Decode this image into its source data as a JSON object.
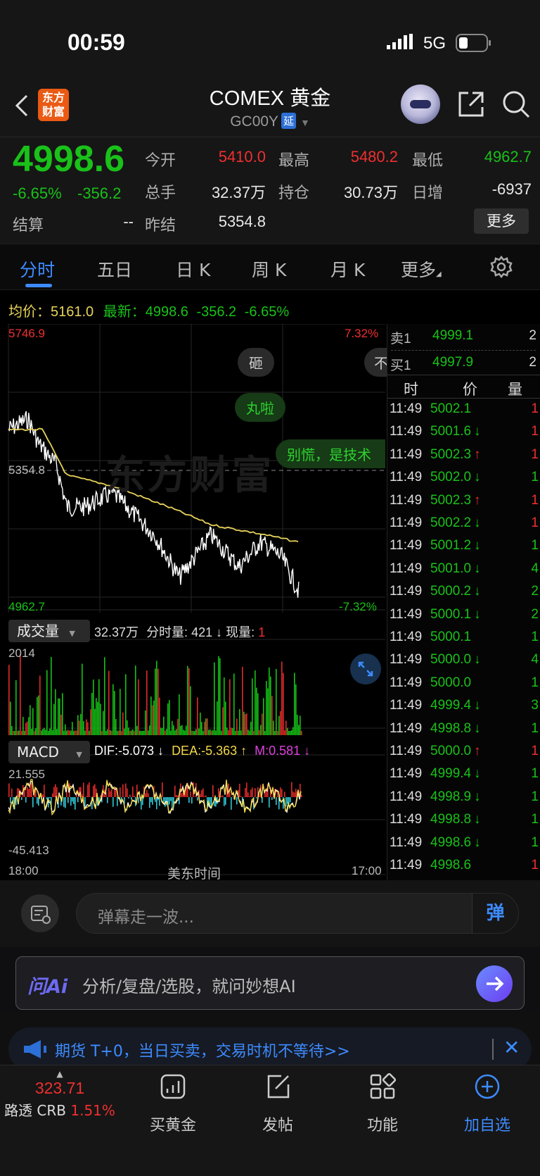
{
  "status_bar": {
    "time": "00:59",
    "network": "5G"
  },
  "header": {
    "brand_line1": "东方",
    "brand_line2": "财富",
    "title": "COMEX 黄金",
    "code": "GC00Y",
    "delay_badge": "延"
  },
  "quote": {
    "price": "4998.6",
    "change_pct": "-6.65%",
    "change": "-356.2",
    "open_label": "今开",
    "open": "5410.0",
    "high_label": "最高",
    "high": "5480.2",
    "low_label": "最低",
    "low": "4962.7",
    "volume_label": "总手",
    "volume": "32.37万",
    "position_label": "持仓",
    "position": "30.73万",
    "daily_inc_label": "日增",
    "daily_inc": "-6937",
    "settle_label": "结算",
    "settle": "--",
    "prev_settle_label": "昨结",
    "prev_settle": "5354.8",
    "more_button": "更多"
  },
  "tabs": [
    "分时",
    "五日",
    "日 K",
    "周 K",
    "月 K",
    "更多"
  ],
  "avg_line": {
    "avg_label": "均价：",
    "avg": "5161.0",
    "latest_label": "最新：",
    "latest": "4998.6",
    "change": "-356.2",
    "pct": "-6.65%"
  },
  "price_axis": {
    "top": "5746.9",
    "mid": "5354.8",
    "bottom": "4962.7",
    "top_pct": "7.32%",
    "bottom_pct": "-7.32%"
  },
  "danmaku": [
    "砸",
    "丸啦",
    "别慌，是技术",
    "不"
  ],
  "watermark": "东方财富",
  "volume_bar": {
    "selector": "成交量",
    "total": "32.37万",
    "period_label": "分时量:",
    "period": "421",
    "cur_label": "现量:",
    "cur": "1",
    "axis_top": "2014"
  },
  "macd_bar": {
    "selector": "MACD",
    "dif": "DIF:-5.073",
    "dea": "DEA:-5.363",
    "m": "M:0.581",
    "axis_top": "21.555",
    "axis_bottom": "-45.413"
  },
  "time_axis": {
    "start": "18:00",
    "mid": "美东时间",
    "end": "17:00"
  },
  "order_book": {
    "sell_label": "卖1",
    "sell_price": "4999.1",
    "sell_qty": "2",
    "buy_label": "买1",
    "buy_price": "4997.9",
    "buy_qty": "2"
  },
  "trades_header": {
    "time": "时",
    "price": "价",
    "qty": "量"
  },
  "trades": [
    {
      "time": "11:49",
      "price": "5002.1",
      "arrow": "",
      "qty": "1",
      "qc": "red"
    },
    {
      "time": "11:49",
      "price": "5001.6",
      "arrow": "↓",
      "qty": "1",
      "qc": "red"
    },
    {
      "time": "11:49",
      "price": "5002.3",
      "arrow": "↑",
      "qty": "1",
      "qc": "red"
    },
    {
      "time": "11:49",
      "price": "5002.0",
      "arrow": "↓",
      "qty": "1",
      "qc": "green"
    },
    {
      "time": "11:49",
      "price": "5002.3",
      "arrow": "↑",
      "qty": "1",
      "qc": "red"
    },
    {
      "time": "11:49",
      "price": "5002.2",
      "arrow": "↓",
      "qty": "1",
      "qc": "red"
    },
    {
      "time": "11:49",
      "price": "5001.2",
      "arrow": "↓",
      "qty": "1",
      "qc": "green"
    },
    {
      "time": "11:49",
      "price": "5001.0",
      "arrow": "↓",
      "qty": "4",
      "qc": "green"
    },
    {
      "time": "11:49",
      "price": "5000.2",
      "arrow": "↓",
      "qty": "2",
      "qc": "green"
    },
    {
      "time": "11:49",
      "price": "5000.1",
      "arrow": "↓",
      "qty": "2",
      "qc": "green"
    },
    {
      "time": "11:49",
      "price": "5000.1",
      "arrow": "",
      "qty": "1",
      "qc": "green"
    },
    {
      "time": "11:49",
      "price": "5000.0",
      "arrow": "↓",
      "qty": "4",
      "qc": "green"
    },
    {
      "time": "11:49",
      "price": "5000.0",
      "arrow": "",
      "qty": "1",
      "qc": "green"
    },
    {
      "time": "11:49",
      "price": "4999.4",
      "arrow": "↓",
      "qty": "3",
      "qc": "green"
    },
    {
      "time": "11:49",
      "price": "4998.8",
      "arrow": "↓",
      "qty": "1",
      "qc": "green"
    },
    {
      "time": "11:49",
      "price": "5000.0",
      "arrow": "↑",
      "qty": "1",
      "qc": "red"
    },
    {
      "time": "11:49",
      "price": "4999.4",
      "arrow": "↓",
      "qty": "1",
      "qc": "green"
    },
    {
      "time": "11:49",
      "price": "4998.9",
      "arrow": "↓",
      "qty": "1",
      "qc": "green"
    },
    {
      "time": "11:49",
      "price": "4998.8",
      "arrow": "↓",
      "qty": "1",
      "qc": "green"
    },
    {
      "time": "11:49",
      "price": "4998.6",
      "arrow": "↓",
      "qty": "1",
      "qc": "green"
    },
    {
      "time": "11:49",
      "price": "4998.6",
      "arrow": "",
      "qty": "1",
      "qc": "red"
    }
  ],
  "danmaku_input": {
    "placeholder": "弹幕走一波...",
    "send": "弹"
  },
  "ai_bar": {
    "brand": "问Ai",
    "placeholder": "分析/复盘/选股，就问妙想AI"
  },
  "notice": {
    "text": "期货 T+0，当日买卖，交易时机不等待>>"
  },
  "bottom_nav": {
    "index_value": "323.71",
    "index_name": "路透 CRB",
    "index_pct": "1.51%",
    "items": [
      "买黄金",
      "发帖",
      "功能",
      "加自选"
    ]
  },
  "colors": {
    "up": "#f02f2f",
    "down": "#19c119",
    "accent": "#3d8bff",
    "avg_line": "#e8d35a",
    "macd_dif": "#ffffff",
    "macd_dea": "#f2d84a",
    "macd_m": "#e040e0"
  }
}
